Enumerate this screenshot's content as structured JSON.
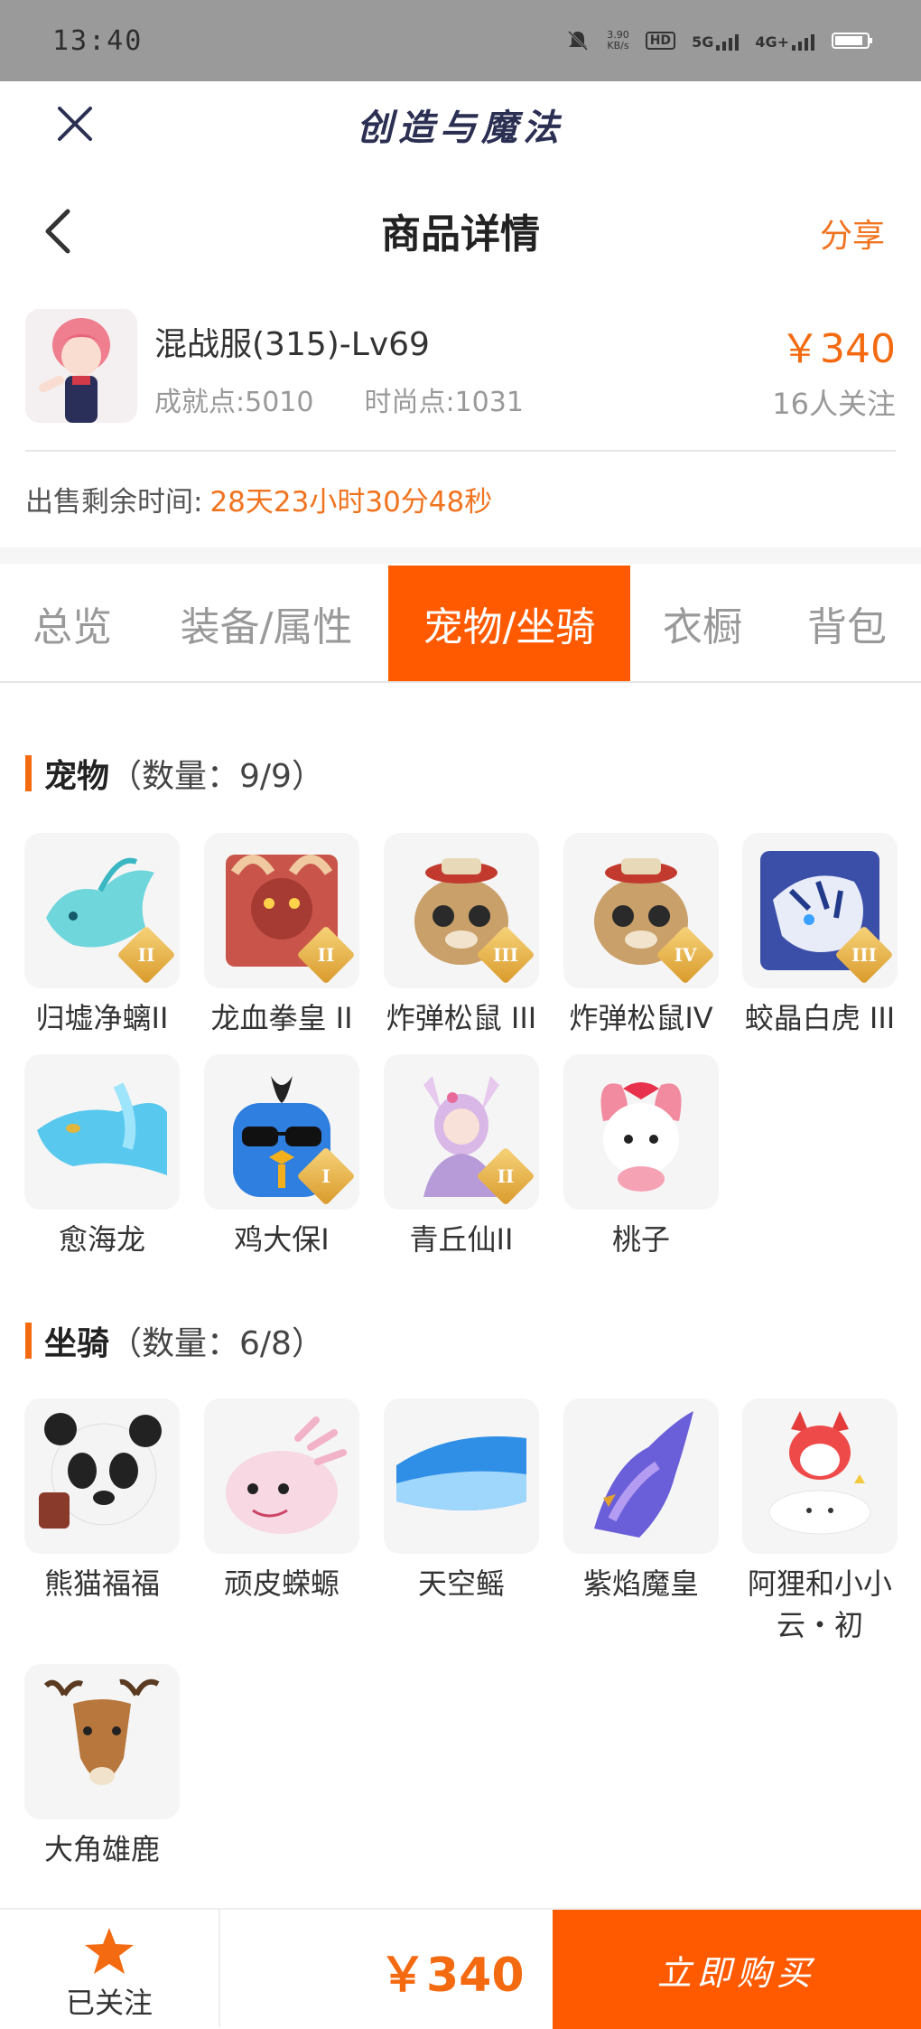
{
  "status_bar": {
    "time": "13:40",
    "net_speed_top": "3.90",
    "net_speed_bottom": "KB/s",
    "hd": "HD",
    "sim1": "5G",
    "sim2": "4G+"
  },
  "app": {
    "title": "创造与魔法"
  },
  "nav": {
    "title": "商品详情",
    "share": "分享"
  },
  "product": {
    "name": "混战服(315)-Lv69",
    "achievement": "成就点:5010",
    "fashion": "时尚点:1031",
    "price": "￥340",
    "followers": "16人关注",
    "remain_label": "出售剩余时间:",
    "remain_time": "28天23小时30分48秒"
  },
  "tabs": [
    "总览",
    "装备/属性",
    "宠物/坐骑",
    "衣橱",
    "背包"
  ],
  "active_tab": "宠物/坐骑",
  "pets": {
    "title": "宠物",
    "count": "（数量：9/9）",
    "items": [
      {
        "name": "归墟净螭II",
        "badge": "II"
      },
      {
        "name": "龙血拳皇 II",
        "badge": "II"
      },
      {
        "name": "炸弹松鼠 III",
        "badge": "III"
      },
      {
        "name": "炸弹松鼠IV",
        "badge": "IV"
      },
      {
        "name": "蛟晶白虎 III",
        "badge": "III"
      },
      {
        "name": "愈海龙",
        "badge": ""
      },
      {
        "name": "鸡大保I",
        "badge": "I"
      },
      {
        "name": "青丘仙II",
        "badge": "II"
      },
      {
        "name": "桃子",
        "badge": ""
      }
    ]
  },
  "mounts": {
    "title": "坐骑",
    "count": "（数量：6/8）",
    "items": [
      {
        "name": "熊猫福福"
      },
      {
        "name": "顽皮蝾螈"
      },
      {
        "name": "天空鳐"
      },
      {
        "name": "紫焰魔皇"
      },
      {
        "name": "阿狸和小小云・初"
      },
      {
        "name": "大角雄鹿"
      }
    ]
  },
  "bottom": {
    "fav_label": "已关注",
    "price": "￥340",
    "buy_label": "立即购买"
  },
  "colors": {
    "accent": "#ff5a00",
    "price": "#f36a10",
    "status_bar": "#9a9a9a"
  }
}
